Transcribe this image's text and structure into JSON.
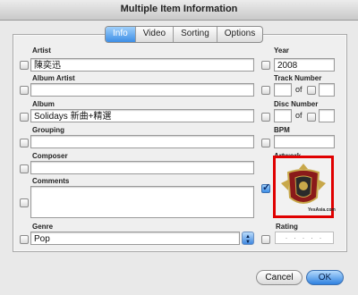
{
  "window": {
    "title": "Multiple Item Information"
  },
  "tabs": [
    {
      "label": "Info",
      "active": true
    },
    {
      "label": "Video",
      "active": false
    },
    {
      "label": "Sorting",
      "active": false
    },
    {
      "label": "Options",
      "active": false
    }
  ],
  "fields": {
    "artist": {
      "label": "Artist",
      "value": "陳奕迅"
    },
    "album_artist": {
      "label": "Album Artist",
      "value": ""
    },
    "album": {
      "label": "Album",
      "value": "Solidays 新曲+精選"
    },
    "grouping": {
      "label": "Grouping",
      "value": ""
    },
    "composer": {
      "label": "Composer",
      "value": ""
    },
    "comments": {
      "label": "Comments",
      "value": ""
    },
    "genre": {
      "label": "Genre",
      "value": "Pop"
    },
    "year": {
      "label": "Year",
      "value": "2008"
    },
    "track_number": {
      "label": "Track Number",
      "value": "",
      "of_label": "of",
      "total": ""
    },
    "disc_number": {
      "label": "Disc Number",
      "value": "",
      "of_label": "of",
      "total": ""
    },
    "bpm": {
      "label": "BPM",
      "value": ""
    },
    "artwork": {
      "label": "Artwork",
      "checked": true,
      "caption": "YesAsia.com"
    },
    "rating": {
      "label": "Rating",
      "stars": 0,
      "placeholder": "· · · · ·"
    }
  },
  "buttons": {
    "cancel": "Cancel",
    "ok": "OK"
  },
  "colors": {
    "artwork_highlight": "#e00000",
    "accent": "#3d8ee6"
  }
}
